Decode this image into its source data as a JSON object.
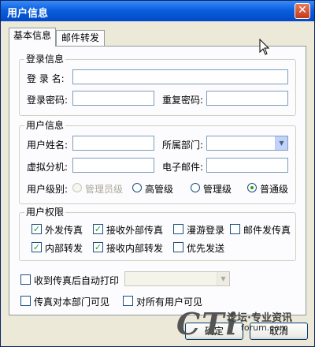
{
  "window": {
    "title": "用户信息",
    "close_symbol": "✕"
  },
  "tabs": [
    {
      "label": "基本信息",
      "active": true
    },
    {
      "label": "邮件转发",
      "active": false
    }
  ],
  "login_group": {
    "title": "登录信息",
    "username_label": "登 录 名:",
    "username_value": "",
    "password_label": "登录密码:",
    "password_value": "",
    "repeat_password_label": "重复密码:",
    "repeat_password_value": ""
  },
  "user_group": {
    "title": "用户信息",
    "name_label": "用户姓名:",
    "name_value": "",
    "department_label": "所属部门:",
    "department_value": "",
    "extension_label": "虚拟分机:",
    "extension_value": "",
    "email_label": "电子邮件:",
    "email_value": "",
    "level_label": "用户级别:",
    "levels": [
      {
        "label": "管理员级",
        "selected": false,
        "disabled": true
      },
      {
        "label": "高管级",
        "selected": false,
        "disabled": false
      },
      {
        "label": "管理级",
        "selected": false,
        "disabled": false
      },
      {
        "label": "普通级",
        "selected": true,
        "disabled": false
      }
    ]
  },
  "permissions_group": {
    "title": "用户权限",
    "items": [
      {
        "label": "外发传真",
        "checked": true
      },
      {
        "label": "接收外部传真",
        "checked": true
      },
      {
        "label": "漫游登录",
        "checked": false
      },
      {
        "label": "邮件发传真",
        "checked": false
      },
      {
        "label": "内部转发",
        "checked": true
      },
      {
        "label": "接收内部转发",
        "checked": true
      },
      {
        "label": "优先发送",
        "checked": false
      }
    ]
  },
  "options": {
    "auto_print_label": "收到传真后自动打印",
    "auto_print_checked": false,
    "printer_value": "",
    "dept_visible_label": "传真对本部门可见",
    "dept_visible_checked": false,
    "all_visible_label": "对所有用户可见",
    "all_visible_checked": false
  },
  "buttons": {
    "ok": "确定",
    "cancel": "取消"
  },
  "watermark": {
    "logo": "CTi",
    "tagline": "论坛·专业资讯",
    "url": "forum.com"
  },
  "colors": {
    "titlebar": "#0a5fe0",
    "check": "#21a121",
    "panel": "#fcfcfe",
    "dialog": "#ece9d8"
  }
}
